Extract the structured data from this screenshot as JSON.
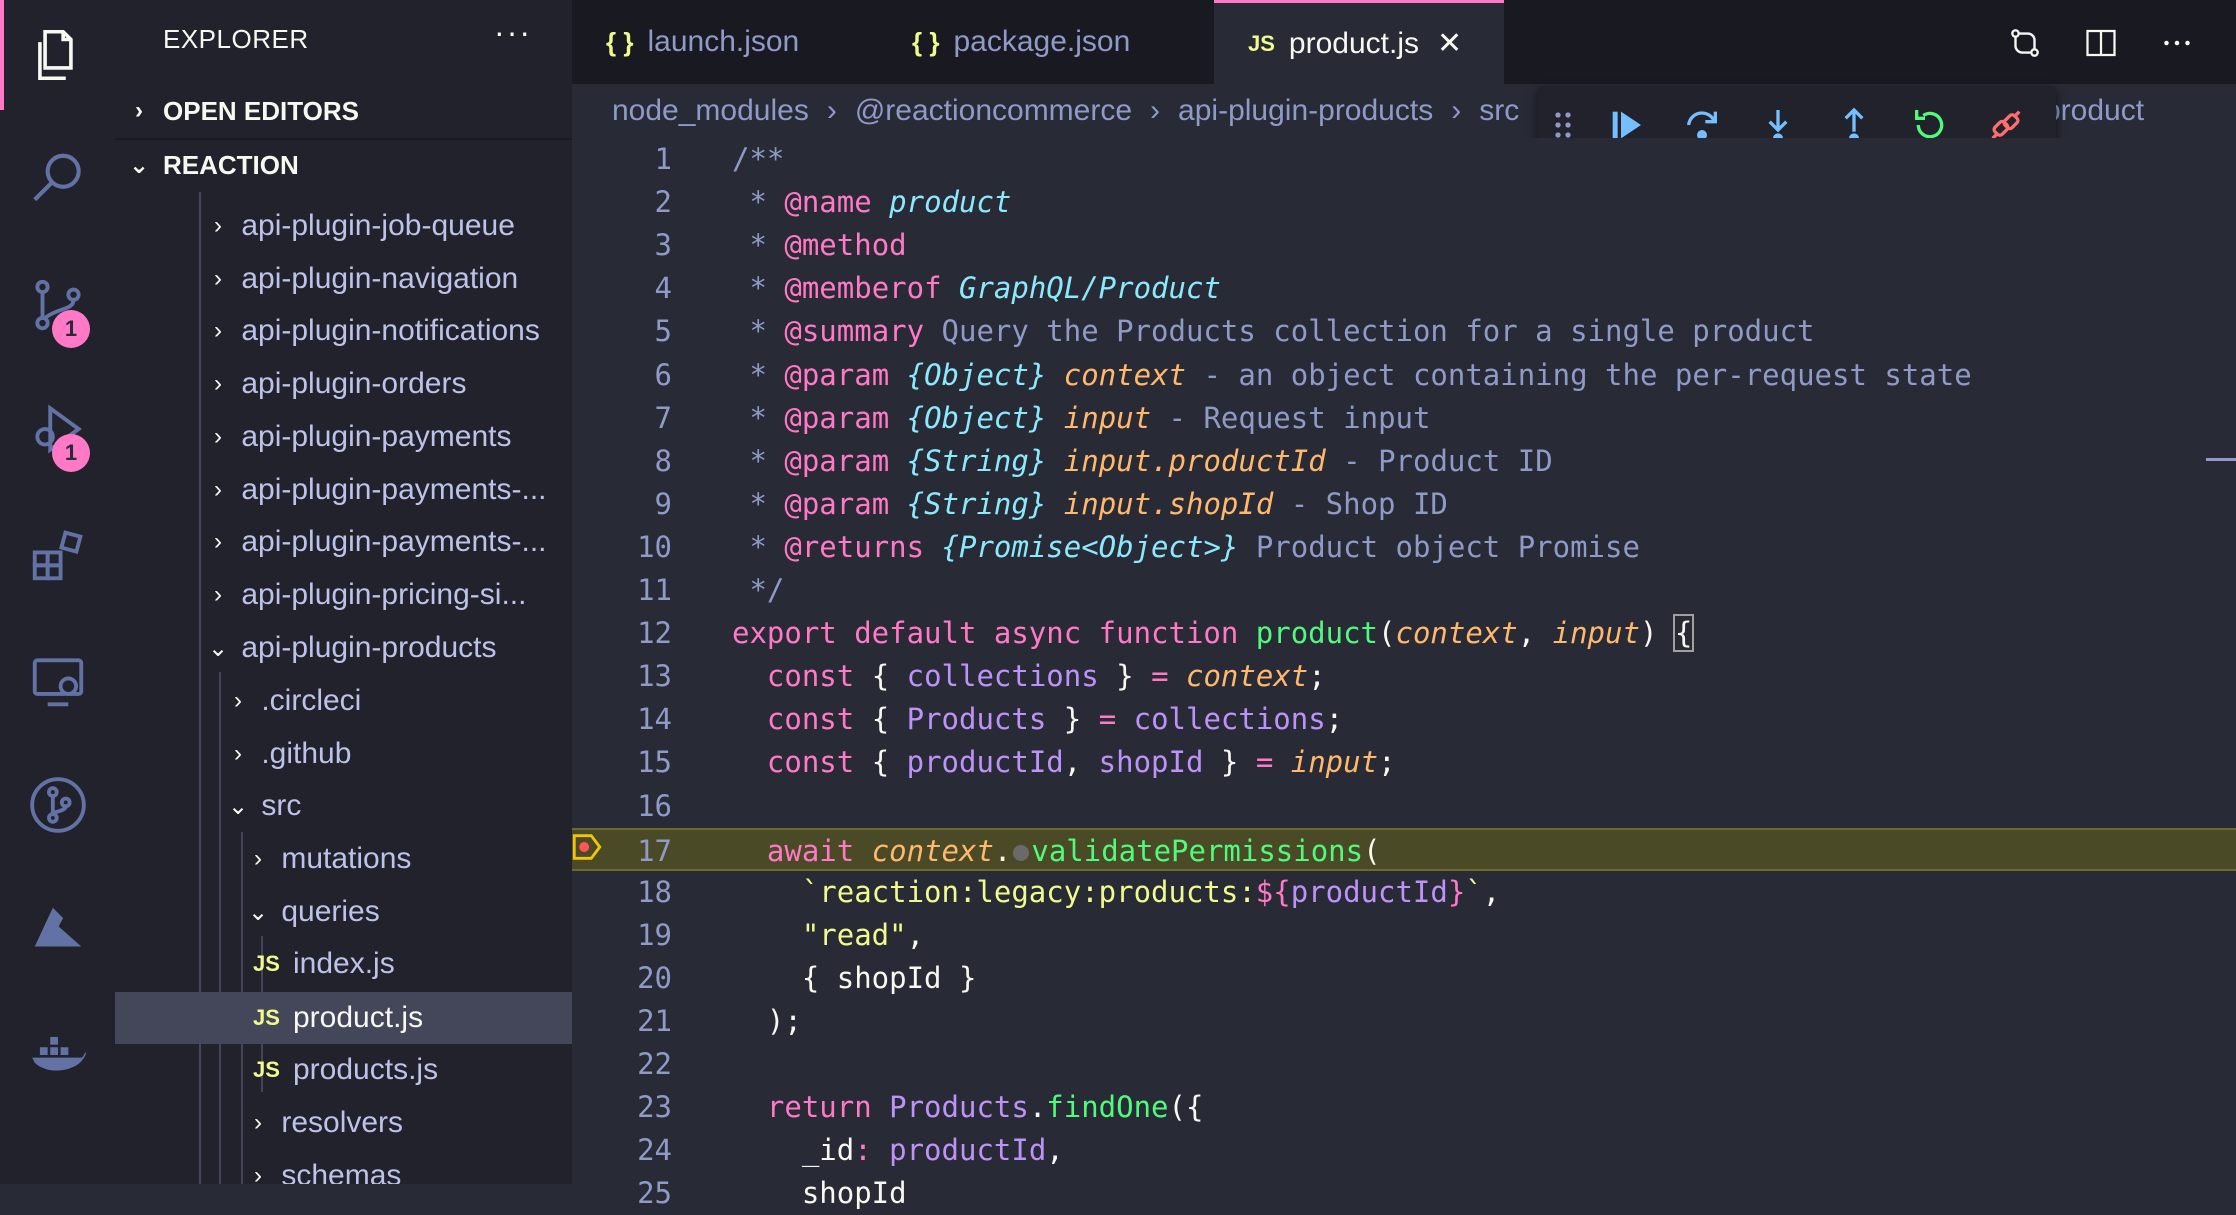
{
  "colors": {
    "accent": "#ff79c6",
    "selection": "#44475a",
    "debug_line": "#4a4a26"
  },
  "activity_bar": {
    "items": [
      {
        "name": "explorer-icon"
      },
      {
        "name": "search-icon"
      },
      {
        "name": "source-control-icon",
        "badge": "1"
      },
      {
        "name": "run-debug-icon",
        "badge": "1"
      },
      {
        "name": "extensions-icon"
      },
      {
        "name": "remote-explorer-icon"
      },
      {
        "name": "git-graph-icon"
      },
      {
        "name": "azure-icon"
      },
      {
        "name": "docker-icon"
      }
    ]
  },
  "sidebar": {
    "title": "EXPLORER",
    "more": "···",
    "sections": {
      "open_editors": "OPEN EDITORS",
      "workspace": "REACTION"
    },
    "tree": [
      {
        "label": "api-plugin-job-queue",
        "chev": "›"
      },
      {
        "label": "api-plugin-navigation",
        "chev": "›"
      },
      {
        "label": "api-plugin-notifications",
        "chev": "›"
      },
      {
        "label": "api-plugin-orders",
        "chev": "›"
      },
      {
        "label": "api-plugin-payments",
        "chev": "›"
      },
      {
        "label": "api-plugin-payments-...",
        "chev": "›"
      },
      {
        "label": "api-plugin-payments-...",
        "chev": "›"
      },
      {
        "label": "api-plugin-pricing-si...",
        "chev": "›"
      },
      {
        "label": "api-plugin-products",
        "chev": "⌄"
      },
      {
        "label": ".circleci",
        "chev": "›"
      },
      {
        "label": ".github",
        "chev": "›"
      },
      {
        "label": "src",
        "chev": "⌄"
      },
      {
        "label": "mutations",
        "chev": "›"
      },
      {
        "label": "queries",
        "chev": "⌄"
      },
      {
        "label": "index.js",
        "icon": "JS"
      },
      {
        "label": "product.js",
        "icon": "JS"
      },
      {
        "label": "products.js",
        "icon": "JS"
      },
      {
        "label": "resolvers",
        "chev": "›"
      },
      {
        "label": "schemas",
        "chev": "›"
      }
    ]
  },
  "tabs": [
    {
      "label": "launch.json",
      "icon": "{ }"
    },
    {
      "label": "package.json",
      "icon": "{ }"
    },
    {
      "label": "product.js",
      "icon": "JS",
      "close": "✕"
    }
  ],
  "breadcrumb": {
    "crumbs": [
      "node_modules",
      "@reactioncommerce",
      "api-plugin-products",
      "src"
    ],
    "sep": "›",
    "tail": "product"
  },
  "debug_toolbar": [
    "grip",
    "continue",
    "step-over",
    "step-into",
    "step-out",
    "restart",
    "disconnect"
  ],
  "editor": {
    "lines": [
      {
        "n": "1",
        "tokens": [
          [
            "c-com",
            "/**"
          ]
        ]
      },
      {
        "n": "2",
        "tokens": [
          [
            "c-com",
            " * "
          ],
          [
            "c-tag",
            "@name"
          ],
          [
            "c-com",
            " "
          ],
          [
            "c-type",
            "product"
          ]
        ]
      },
      {
        "n": "3",
        "tokens": [
          [
            "c-com",
            " * "
          ],
          [
            "c-tag",
            "@method"
          ]
        ]
      },
      {
        "n": "4",
        "tokens": [
          [
            "c-com",
            " * "
          ],
          [
            "c-tag",
            "@memberof"
          ],
          [
            "c-com",
            " "
          ],
          [
            "c-type",
            "GraphQL/Product"
          ]
        ]
      },
      {
        "n": "5",
        "tokens": [
          [
            "c-com",
            " * "
          ],
          [
            "c-tag",
            "@summary"
          ],
          [
            "c-com",
            " Query the Products collection for a single product"
          ]
        ]
      },
      {
        "n": "6",
        "tokens": [
          [
            "c-com",
            " * "
          ],
          [
            "c-tag",
            "@param"
          ],
          [
            "c-com",
            " "
          ],
          [
            "c-type",
            "{Object}"
          ],
          [
            "c-com",
            " "
          ],
          [
            "c-param",
            "context"
          ],
          [
            "c-com",
            " - an object containing the per-request state"
          ]
        ]
      },
      {
        "n": "7",
        "tokens": [
          [
            "c-com",
            " * "
          ],
          [
            "c-tag",
            "@param"
          ],
          [
            "c-com",
            " "
          ],
          [
            "c-type",
            "{Object}"
          ],
          [
            "c-com",
            " "
          ],
          [
            "c-param",
            "input"
          ],
          [
            "c-com",
            " - Request input"
          ]
        ]
      },
      {
        "n": "8",
        "tokens": [
          [
            "c-com",
            " * "
          ],
          [
            "c-tag",
            "@param"
          ],
          [
            "c-com",
            " "
          ],
          [
            "c-type",
            "{String}"
          ],
          [
            "c-com",
            " "
          ],
          [
            "c-param",
            "input.productId"
          ],
          [
            "c-com",
            " - Product ID"
          ]
        ]
      },
      {
        "n": "9",
        "tokens": [
          [
            "c-com",
            " * "
          ],
          [
            "c-tag",
            "@param"
          ],
          [
            "c-com",
            " "
          ],
          [
            "c-type",
            "{String}"
          ],
          [
            "c-com",
            " "
          ],
          [
            "c-param",
            "input.shopId"
          ],
          [
            "c-com",
            " - Shop ID"
          ]
        ]
      },
      {
        "n": "10",
        "tokens": [
          [
            "c-com",
            " * "
          ],
          [
            "c-tag",
            "@returns"
          ],
          [
            "c-com",
            " "
          ],
          [
            "c-type",
            "{Promise<Object>}"
          ],
          [
            "c-com",
            " Product object Promise"
          ]
        ]
      },
      {
        "n": "11",
        "tokens": [
          [
            "c-com",
            " */"
          ]
        ]
      },
      {
        "n": "12",
        "tokens": [
          [
            "c-kw",
            "export default async function "
          ],
          [
            "c-fn",
            "product"
          ],
          [
            "c-plain",
            "("
          ],
          [
            "c-param",
            "context"
          ],
          [
            "c-plain",
            ", "
          ],
          [
            "c-param",
            "input"
          ],
          [
            "c-plain",
            ") "
          ],
          [
            "c-plain bracket-box",
            "{"
          ]
        ]
      },
      {
        "n": "13",
        "tokens": [
          [
            "c-kw",
            "  const "
          ],
          [
            "c-plain",
            "{ "
          ],
          [
            "c-var",
            "collections"
          ],
          [
            "c-plain",
            " } "
          ],
          [
            "c-kw",
            "= "
          ],
          [
            "c-param",
            "context"
          ],
          [
            "c-plain",
            ";"
          ]
        ]
      },
      {
        "n": "14",
        "tokens": [
          [
            "c-kw",
            "  const "
          ],
          [
            "c-plain",
            "{ "
          ],
          [
            "c-var",
            "Products"
          ],
          [
            "c-plain",
            " } "
          ],
          [
            "c-kw",
            "= "
          ],
          [
            "c-var",
            "collections"
          ],
          [
            "c-plain",
            ";"
          ]
        ]
      },
      {
        "n": "15",
        "tokens": [
          [
            "c-kw",
            "  const "
          ],
          [
            "c-plain",
            "{ "
          ],
          [
            "c-var",
            "productId"
          ],
          [
            "c-plain",
            ", "
          ],
          [
            "c-var",
            "shopId"
          ],
          [
            "c-plain",
            " } "
          ],
          [
            "c-kw",
            "= "
          ],
          [
            "c-param",
            "input"
          ],
          [
            "c-plain",
            ";"
          ]
        ]
      },
      {
        "n": "16",
        "tokens": []
      },
      {
        "n": "17",
        "hl": true,
        "tokens": [
          [
            "c-kw",
            "  await "
          ],
          [
            "c-param",
            "context"
          ],
          [
            "c-plain",
            "."
          ],
          [
            "dot",
            ""
          ],
          [
            "c-fn",
            "validatePermissions"
          ],
          [
            "c-plain",
            "("
          ]
        ]
      },
      {
        "n": "18",
        "tokens": [
          [
            "c-str",
            "    `reaction:legacy:products:"
          ],
          [
            "c-kw",
            "${"
          ],
          [
            "c-var",
            "productId"
          ],
          [
            "c-kw",
            "}"
          ],
          [
            "c-str",
            "`"
          ],
          [
            "c-plain",
            ","
          ]
        ]
      },
      {
        "n": "19",
        "tokens": [
          [
            "c-str",
            "    \"read\""
          ],
          [
            "c-plain",
            ","
          ]
        ]
      },
      {
        "n": "20",
        "tokens": [
          [
            "c-plain",
            "    { shopId }"
          ]
        ]
      },
      {
        "n": "21",
        "tokens": [
          [
            "c-plain",
            "  );"
          ]
        ]
      },
      {
        "n": "22",
        "tokens": []
      },
      {
        "n": "23",
        "tokens": [
          [
            "c-kw",
            "  return "
          ],
          [
            "c-var",
            "Products"
          ],
          [
            "c-plain",
            "."
          ],
          [
            "c-fn",
            "findOne"
          ],
          [
            "c-plain",
            "({"
          ]
        ]
      },
      {
        "n": "24",
        "tokens": [
          [
            "c-plain",
            "    _id"
          ],
          [
            "c-kw",
            ": "
          ],
          [
            "c-var",
            "productId"
          ],
          [
            "c-plain",
            ","
          ]
        ]
      },
      {
        "n": "25",
        "tokens": [
          [
            "c-plain",
            "    shopId"
          ]
        ]
      }
    ]
  }
}
